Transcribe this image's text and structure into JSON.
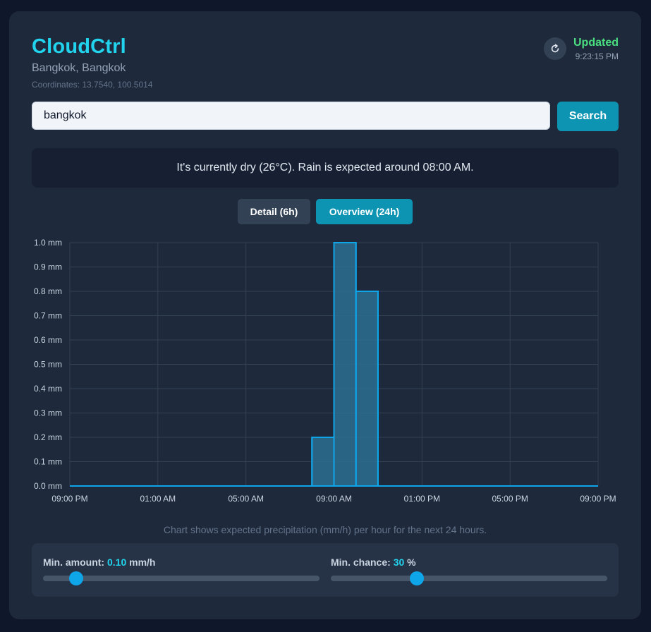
{
  "header": {
    "title": "CloudCtrl",
    "location": "Bangkok, Bangkok",
    "coordinates": "Coordinates: 13.7540, 100.5014",
    "status": "Updated",
    "time": "9:23:15 PM"
  },
  "search": {
    "value": "bangkok",
    "button_label": "Search"
  },
  "summary": "It's currently dry (26°C). Rain is expected around 08:00 AM.",
  "tabs": [
    {
      "label": "Detail (6h)",
      "active": false
    },
    {
      "label": "Overview (24h)",
      "active": true
    }
  ],
  "chart_data": {
    "type": "area",
    "step": true,
    "x_tick_labels": [
      "09:00 PM",
      "01:00 AM",
      "05:00 AM",
      "09:00 AM",
      "01:00 PM",
      "05:00 PM",
      "09:00 PM"
    ],
    "x": [
      0,
      1,
      2,
      3,
      4,
      5,
      6,
      7,
      8,
      9,
      10,
      11,
      12,
      13,
      14,
      15,
      16,
      17,
      18,
      19,
      20,
      21,
      22,
      23,
      24
    ],
    "values": [
      0,
      0,
      0,
      0,
      0,
      0,
      0,
      0,
      0,
      0,
      0,
      0.2,
      1.0,
      0.8,
      0,
      0,
      0,
      0,
      0,
      0,
      0,
      0,
      0,
      0,
      0
    ],
    "y_tick_labels": [
      "0.0 mm",
      "0.1 mm",
      "0.2 mm",
      "0.3 mm",
      "0.4 mm",
      "0.5 mm",
      "0.6 mm",
      "0.7 mm",
      "0.8 mm",
      "0.9 mm",
      "1.0 mm"
    ],
    "ylim": [
      0,
      1.0
    ],
    "grid": true,
    "line_color": "#0ea5e9",
    "fill_color": "#2d6e92"
  },
  "chart_note": "Chart shows expected precipitation (mm/h) per hour for the next 24 hours.",
  "filters": {
    "amount": {
      "label": "Min. amount:",
      "value": "0.10",
      "unit": "mm/h",
      "fraction": 0.12
    },
    "chance": {
      "label": "Min. chance:",
      "value": "30",
      "unit": "%",
      "fraction": 0.31
    }
  },
  "colors": {
    "accent": "#22d3ee",
    "updated": "#4ade80",
    "button": "#0e94b3"
  }
}
